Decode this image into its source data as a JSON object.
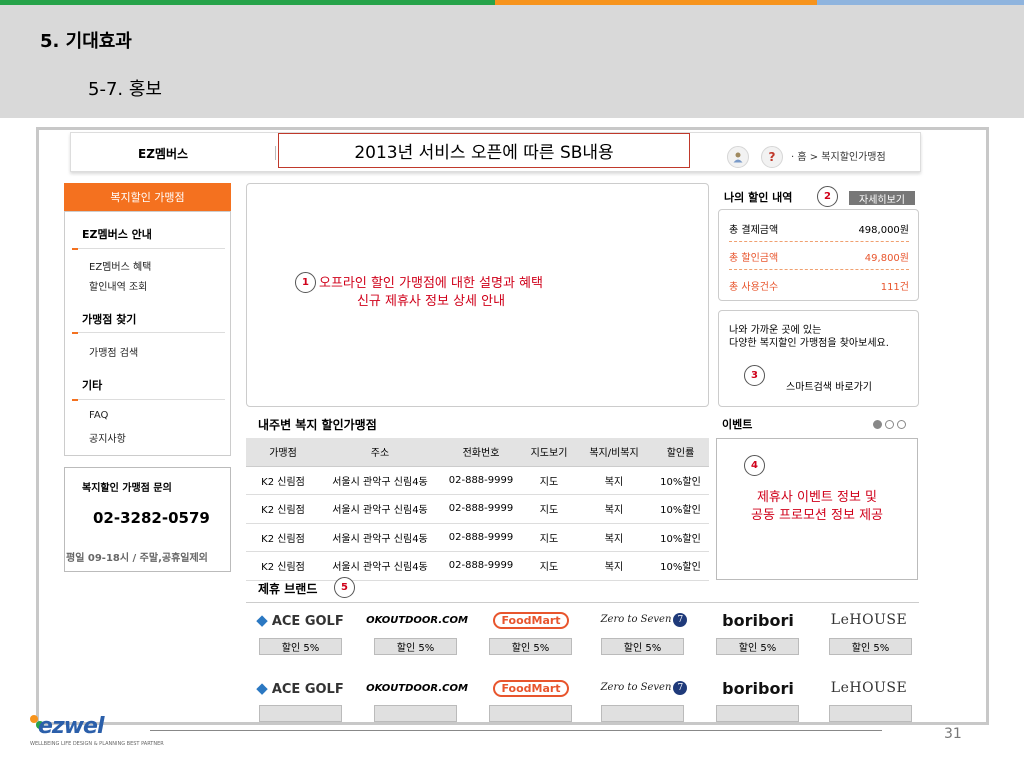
{
  "slide": {
    "section_title": "5. 기대효과",
    "sub_title": "5-7. 홍보",
    "page_number": "31"
  },
  "topnav": {
    "brand": "EZ멤버스",
    "sb_label": "2013년 서비스 오픈에 따른 SB내용",
    "breadcrumb": "· 홈 > 복지할인가맹점",
    "user_icon": "user-icon",
    "help_icon": "?"
  },
  "sidebar": {
    "header": "복지할인 가맹점",
    "groups": [
      {
        "title": "EZ멤버스 안내",
        "items": [
          "EZ멤버스 혜택",
          "할인내역 조회"
        ]
      },
      {
        "title": "가맹점 찾기",
        "items": [
          "가맹점 검색"
        ]
      },
      {
        "title": "기타",
        "items": [
          "FAQ",
          "공지사항"
        ]
      }
    ],
    "inquiry": {
      "title": "복지할인 가맹점 문의",
      "phone": "02-3282-0579",
      "hours": "평일 09-18시 / 주말,공휴일제외"
    }
  },
  "main": {
    "line1": "오프라인 할인 가맹점에 대한 설명과 혜택",
    "line2": "신규 제휴사 정보 상세 안내",
    "badge": "1"
  },
  "my_discount": {
    "title": "나의 할인 내역",
    "badge": "2",
    "more": "자세히보기",
    "rows": [
      {
        "label": "총 결제금액",
        "value": "498,000원",
        "color": "#000000"
      },
      {
        "label": "총 할인금액",
        "value": "49,800원",
        "color": "#e8552d"
      },
      {
        "label": "총 사용건수",
        "value": "111건",
        "color": "#e8552d"
      }
    ]
  },
  "nearby_search": {
    "line1": "나와 가까운 곳에 있는",
    "line2": "다양한 복지할인 가맹점을 찾아보세요.",
    "badge": "3",
    "link": "스마트검색 바로가기"
  },
  "nearby_table": {
    "title": "내주변 복지 할인가맹점",
    "columns": [
      "가맹점",
      "주소",
      "전화번호",
      "지도보기",
      "복지/비복지",
      "할인률"
    ],
    "rows": [
      [
        "K2 신림점",
        "서울시 관악구 신림4동",
        "02-888-9999",
        "지도",
        "복지",
        "10%할인"
      ],
      [
        "K2 신림점",
        "서울시 관악구 신림4동",
        "02-888-9999",
        "지도",
        "복지",
        "10%할인"
      ],
      [
        "K2 신림점",
        "서울시 관악구 신림4동",
        "02-888-9999",
        "지도",
        "복지",
        "10%할인"
      ],
      [
        "K2 신림점",
        "서울시 관악구 신림4동",
        "02-888-9999",
        "지도",
        "복지",
        "10%할인"
      ]
    ]
  },
  "event": {
    "title": "이벤트",
    "badge": "4",
    "line1": "제휴사 이벤트 정보 및",
    "line2": "공동 프로모션 정보 제공",
    "dots": 3,
    "active_dot": 0
  },
  "brands": {
    "title": "제휴 브랜드",
    "badge": "5",
    "row1": [
      {
        "name": "ACE GOLF",
        "discount": "할인 5%"
      },
      {
        "name": "OKOUTDOOR.COM",
        "discount": "할인 5%"
      },
      {
        "name": "FoodMart",
        "discount": "할인 5%"
      },
      {
        "name": "Zero to Seven",
        "discount": "할인 5%"
      },
      {
        "name": "boribori",
        "discount": "할인 5%"
      },
      {
        "name": "LeHOUSE",
        "discount": "할인 5%"
      }
    ],
    "row2": [
      {
        "name": "ACE GOLF",
        "discount": ""
      },
      {
        "name": "OKOUTDOOR.COM",
        "discount": ""
      },
      {
        "name": "FoodMart",
        "discount": ""
      },
      {
        "name": "Zero to Seven",
        "discount": ""
      },
      {
        "name": "boribori",
        "discount": ""
      },
      {
        "name": "LeHOUSE",
        "discount": ""
      }
    ]
  },
  "footer": {
    "logo": "ezwel",
    "tagline": "WELLBEING LIFE DESIGN & PLANNING BEST PARTNER"
  },
  "colors": {
    "orange": "#f4711f",
    "red": "#d0021b",
    "green": "#27a34a",
    "blue": "#8fb4de"
  }
}
